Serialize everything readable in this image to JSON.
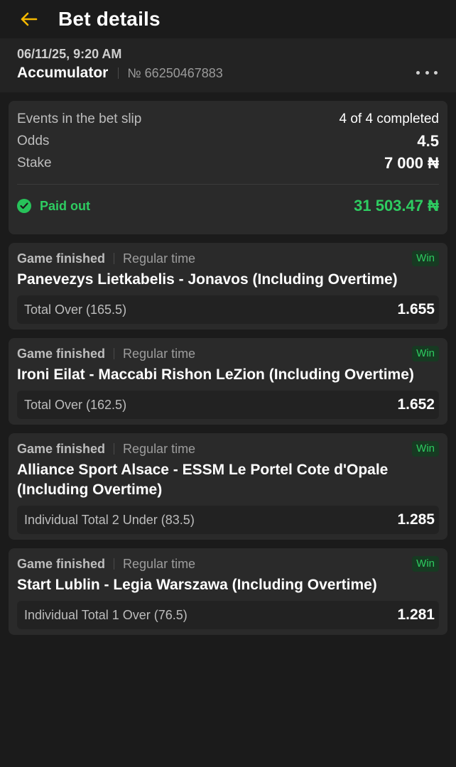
{
  "header": {
    "title": "Bet details",
    "date": "06/11/25, 9:20 AM",
    "bet_type": "Accumulator",
    "bet_number": "№ 66250467883"
  },
  "summary": {
    "events_label": "Events in the bet slip",
    "events_value": "4 of 4 completed",
    "odds_label": "Odds",
    "odds_value": "4.5",
    "stake_label": "Stake",
    "stake_value": "7 000 ₦",
    "paid_label": "Paid out",
    "paid_value": "31 503.47 ₦"
  },
  "events": [
    {
      "status": "Game finished",
      "period": "Regular time",
      "badge": "Win",
      "title": "Panevezys Lietkabelis - Jonavos (Including Overtime)",
      "market": "Total Over (165.5)",
      "odds": "1.655"
    },
    {
      "status": "Game finished",
      "period": "Regular time",
      "badge": "Win",
      "title": "Ironi Eilat - Maccabi Rishon LeZion (Including Overtime)",
      "market": "Total Over (162.5)",
      "odds": "1.652"
    },
    {
      "status": "Game finished",
      "period": "Regular time",
      "badge": "Win",
      "title": "Alliance Sport Alsace - ESSM Le Portel Cote d'Opale (Including Overtime)",
      "market": "Individual Total 2 Under (83.5)",
      "odds": "1.285"
    },
    {
      "status": "Game finished",
      "period": "Regular time",
      "badge": "Win",
      "title": "Start Lublin - Legia Warszawa (Including Overtime)",
      "market": "Individual Total 1 Over (76.5)",
      "odds": "1.281"
    }
  ],
  "colors": {
    "accent": "#f5b800",
    "win_green": "#2ecc61",
    "background": "#1b1b1b",
    "card": "#2a2a2a"
  },
  "icons": {
    "back": "arrow-left-icon",
    "more": "more-horizontal-icon",
    "paid": "check-circle-icon"
  }
}
